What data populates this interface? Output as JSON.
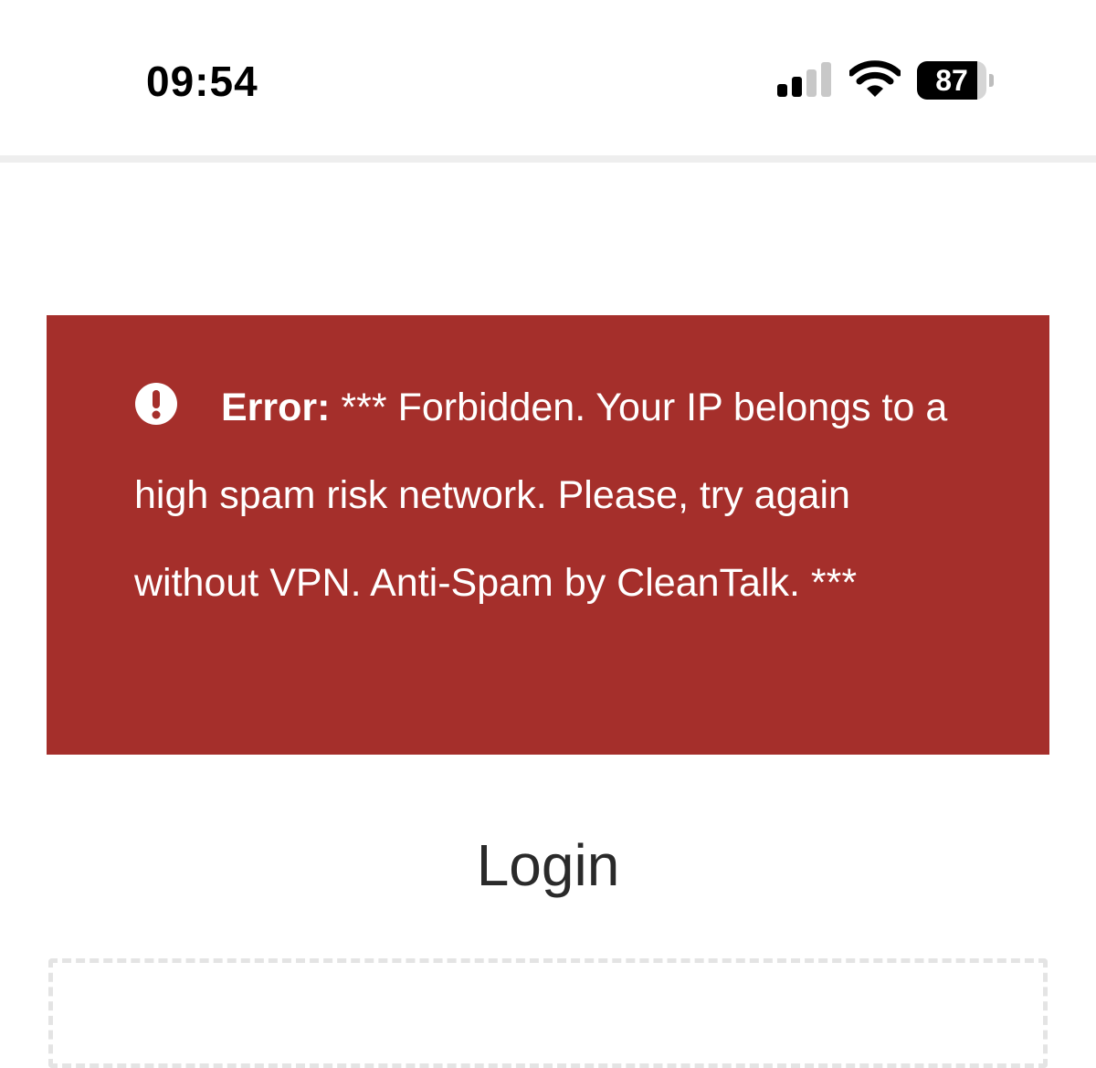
{
  "status_bar": {
    "time": "09:54",
    "battery_percent": "87",
    "battery_level": 0.87,
    "signal_bars_active": 2,
    "signal_bars_total": 4
  },
  "error": {
    "label": "Error:",
    "message": " *** Forbidden. Your IP belongs to a high spam risk network. Please, try again without VPN. Anti-Spam by CleanTalk. ***",
    "icon": "exclamation-circle-icon",
    "background_color": "#a52f2b"
  },
  "login": {
    "title": "Login"
  }
}
